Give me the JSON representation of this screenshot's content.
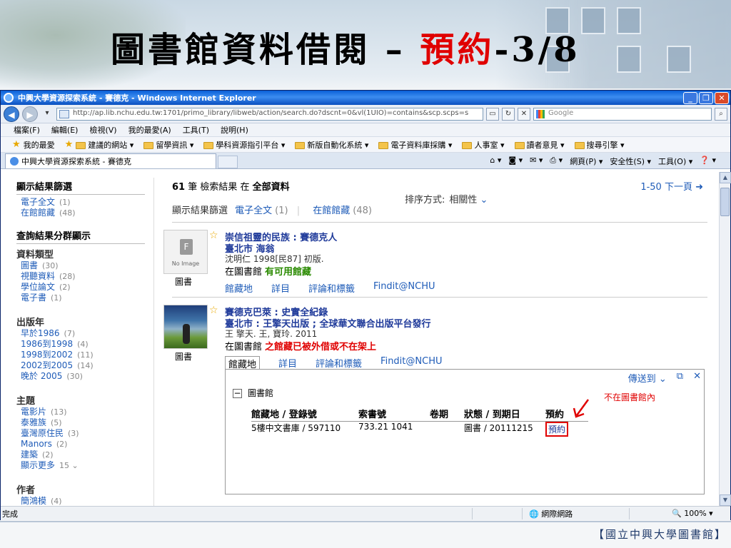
{
  "slide": {
    "title_main": "圖書館資料借閱 – ",
    "title_highlight": "預約",
    "title_suffix": "-3/8",
    "footer": "【國立中興大學圖書館】"
  },
  "window": {
    "title": "中興大學資源探索系統 - 賽德克 - Windows Internet Explorer",
    "url": "http://ap.lib.nchu.edu.tw:1701/primo_library/libweb/action/search.do?dscnt=0&vl(1UIO)=contains&scp.scps=s",
    "search_placeholder": "Google",
    "menu": [
      "檔案(F)",
      "編輯(E)",
      "檢視(V)",
      "我的最愛(A)",
      "工具(T)",
      "說明(H)"
    ],
    "favorites_label": "我的最愛",
    "favorites": [
      "建議的網站 ▾",
      "留學資訊 ▾",
      "學科資源指引平台 ▾",
      "新版自動化系統 ▾",
      "電子資料庫採購 ▾",
      "人事室 ▾",
      "讀者意見 ▾",
      "搜尋引擎 ▾"
    ],
    "tab_title": "中興大學資源探索系統 - 賽德克",
    "tools": [
      "網頁(P) ▾",
      "安全性(S) ▾",
      "工具(O) ▾"
    ],
    "status_left": "完成",
    "status_zone": "網際網路",
    "status_zoom": "100%"
  },
  "facets": {
    "filter_header": "顯示結果篩選",
    "filters": [
      {
        "label": "電子全文",
        "count": "(1)"
      },
      {
        "label": "在館館藏",
        "count": "(48)"
      }
    ],
    "group_header": "查詢結果分群顯示",
    "groups": [
      {
        "title": "資料類型",
        "items": [
          {
            "label": "圖書",
            "count": "(30)"
          },
          {
            "label": "視聽資料",
            "count": "(28)"
          },
          {
            "label": "學位論文",
            "count": "(2)"
          },
          {
            "label": "電子書",
            "count": "(1)"
          }
        ]
      },
      {
        "title": "出版年",
        "items": [
          {
            "label": "早於1986",
            "count": "(7)"
          },
          {
            "label": "1986到1998",
            "count": "(4)"
          },
          {
            "label": "1998到2002",
            "count": "(11)"
          },
          {
            "label": "2002到2005",
            "count": "(14)"
          },
          {
            "label": "晚於 2005",
            "count": "(30)"
          }
        ]
      },
      {
        "title": "主題",
        "items": [
          {
            "label": "電影片",
            "count": "(13)"
          },
          {
            "label": "泰雅族",
            "count": "(5)"
          },
          {
            "label": "臺灣原住民",
            "count": "(3)"
          },
          {
            "label": "Manors",
            "count": "(2)"
          },
          {
            "label": "建築",
            "count": "(2)"
          },
          {
            "label": "顯示更多",
            "count": "15 ⌄"
          }
        ]
      },
      {
        "title": "作者",
        "items": [
          {
            "label": "簡鴻模",
            "count": "(4)"
          }
        ]
      }
    ]
  },
  "results": {
    "count": "61",
    "count_text": " 筆 檢索結果 在 ",
    "scope": "全部資料",
    "pager": "1-50 下一頁 ➜",
    "sort_label": "排序方式:",
    "sort_value": "相關性",
    "sort_dd": "⌄",
    "filter_label": "顯示結果篩選",
    "filter_links": [
      {
        "label": "電子全文",
        "count": "(1)"
      },
      {
        "label": "在館館藏",
        "count": "(48)"
      }
    ],
    "records": [
      {
        "title": "崇信祖靈的民族 : 賽德克人",
        "publisher": "臺北市 海翁",
        "author": "沈明仁 1998[民87] 初版.",
        "avail_prefix": "在圖書館",
        "avail_status": "有可用館藏",
        "type": "圖書",
        "noimage": "No Image",
        "tabs": [
          "館藏地",
          "詳目",
          "評論和標籤",
          "Findit@NCHU"
        ]
      },
      {
        "title": "賽德克巴萊 : 史實全紀錄",
        "publisher": "臺北市 : 王擎天出版 ; 全球華文聯合出版平台發行",
        "author": "王 擎天. 王, 寶玲. 2011",
        "avail_prefix": "在圖書館",
        "avail_status": "之館藏已被外借或不在架上",
        "type": "圖書",
        "tabs": [
          "館藏地",
          "詳目",
          "評論和標籤",
          "Findit@NCHU"
        ]
      }
    ],
    "location": {
      "send_to": "傳送到 ⌄",
      "library": "圖書館",
      "not_in_library": "不在圖書館內",
      "headers": [
        "館藏地 / 登錄號",
        "索書號",
        "卷期",
        "狀態 / 到期日",
        "預約"
      ],
      "row": [
        "5樓中文書庫 / 597110",
        "733.21 1041",
        "",
        "圖書 / 20111215",
        "預約"
      ]
    }
  },
  "colors": {
    "link": "#1f5cb8",
    "alert": "#e00000",
    "ok": "#2a8a00"
  }
}
